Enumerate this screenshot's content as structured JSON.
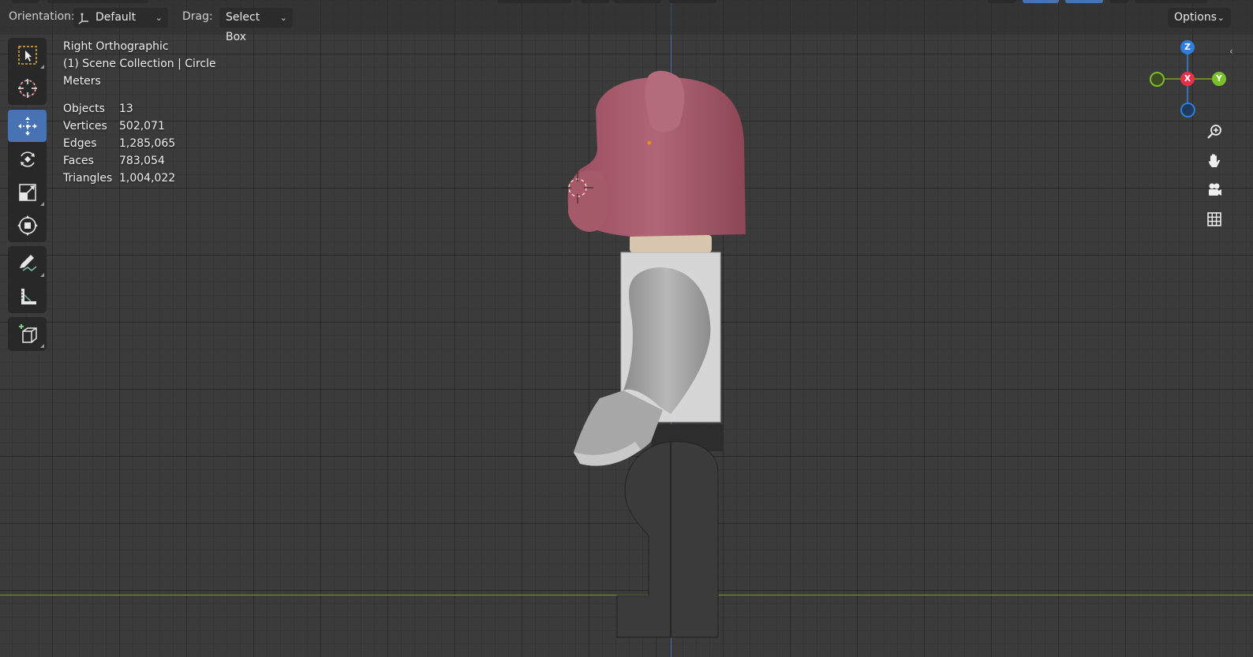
{
  "header": {
    "orientation_label": "Orientation:",
    "orientation_value": "Default",
    "drag_label": "Drag:",
    "drag_value": "Select Box",
    "options_label": "Options"
  },
  "toolbar": {
    "tools": [
      {
        "name": "select-box-tool",
        "icon": "select-box-icon",
        "active": false
      },
      {
        "name": "cursor-tool",
        "icon": "cursor-icon",
        "active": false
      },
      {
        "name": "move-tool",
        "icon": "move-icon",
        "active": true
      },
      {
        "name": "rotate-tool",
        "icon": "rotate-icon",
        "active": false
      },
      {
        "name": "scale-tool",
        "icon": "scale-icon",
        "active": false
      },
      {
        "name": "transform-tool",
        "icon": "transform-icon",
        "active": false
      },
      {
        "name": "annotate-tool",
        "icon": "annotate-icon",
        "active": false
      },
      {
        "name": "measure-tool",
        "icon": "measure-icon",
        "active": false
      },
      {
        "name": "add-cube-tool",
        "icon": "add-cube-icon",
        "active": false
      }
    ]
  },
  "overlay": {
    "view_name": "Right Orthographic",
    "collection": "(1) Scene Collection | Circle",
    "units": "Meters",
    "stats": [
      {
        "label": "Objects",
        "value": "13"
      },
      {
        "label": "Vertices",
        "value": "502,071"
      },
      {
        "label": "Edges",
        "value": "1,285,065"
      },
      {
        "label": "Faces",
        "value": "783,054"
      },
      {
        "label": "Triangles",
        "value": "1,004,022"
      }
    ]
  },
  "gizmo": {
    "z_label": "Z",
    "x_label": "X",
    "y_label": "Y",
    "z_color": "#2e7de0",
    "x_color": "#e8304a",
    "y_color": "#7ac02a"
  },
  "nav": {
    "buttons": [
      "zoom-icon",
      "pan-hand-icon",
      "camera-icon",
      "grid-view-icon"
    ]
  },
  "colors": {
    "accent": "#4772b3",
    "head": "#a65a6b",
    "torso": "#d8d8d8",
    "legs": "#3a3a3a",
    "neck": "#d9c9b0"
  }
}
